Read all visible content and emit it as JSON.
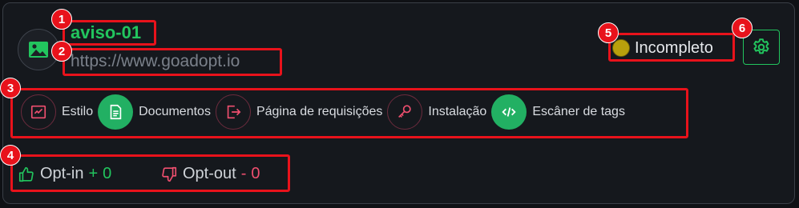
{
  "header": {
    "title": "aviso-01",
    "url": "https://www.goadopt.io",
    "status_label": "Incompleto",
    "avatar_icon": "image-icon",
    "settings_icon": "gear-icon"
  },
  "steps": [
    {
      "label": "Estilo",
      "icon": "chart-icon",
      "completed": false
    },
    {
      "label": "Documentos",
      "icon": "document-icon",
      "completed": true
    },
    {
      "label": "Página de requisições",
      "icon": "sign-out-icon",
      "completed": false
    },
    {
      "label": "Instalação",
      "icon": "key-icon",
      "completed": false
    },
    {
      "label": "Escâner de tags",
      "icon": "code-icon",
      "completed": true
    }
  ],
  "optin": {
    "label": "Opt-in",
    "sign": "+",
    "value": "0"
  },
  "optout": {
    "label": "Opt-out",
    "sign": "-",
    "value": "0"
  },
  "annotations": [
    "1",
    "2",
    "3",
    "4",
    "5",
    "6"
  ],
  "colors": {
    "accent": "#22c55e",
    "highlight": "#e8121b",
    "negative": "#ef4f6f",
    "status_dot": "#b9a00c"
  }
}
